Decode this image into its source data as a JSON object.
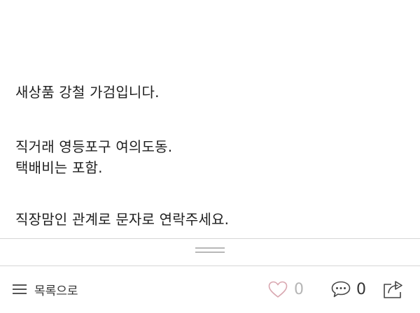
{
  "post": {
    "lines": [
      "새상품 강철 가검입니다.",
      "직거래 영등포구 여의도동.",
      "택배비는 포함.",
      "직장맘인 관계로 문자로 연락주세요."
    ]
  },
  "toolbar": {
    "list_label": "목록으로",
    "list_icon": "hamburger-menu-icon",
    "like_icon": "heart-icon",
    "like_count": "0",
    "comment_icon": "speech-bubble-icon",
    "comment_count": "0",
    "share_icon": "share-icon"
  },
  "colors": {
    "text": "#1e1e1e",
    "divider": "#d6d6d6",
    "like_inactive": "#d9a7b0",
    "like_count": "#b5b5b5",
    "icon": "#555555"
  }
}
